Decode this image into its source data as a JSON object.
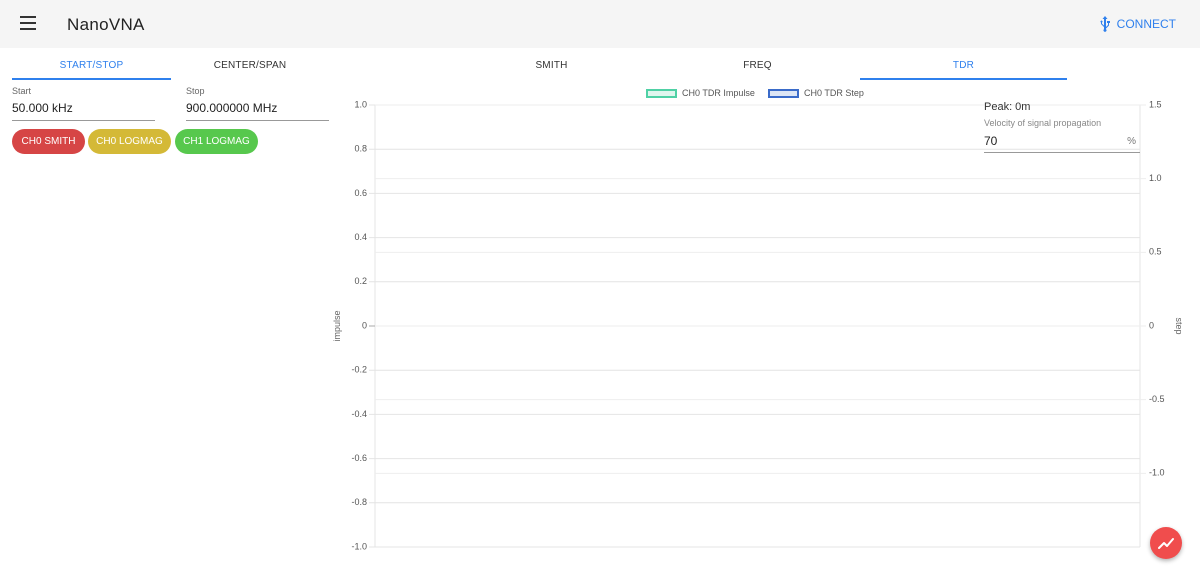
{
  "app": {
    "title": "NanoVNA",
    "connect_label": "CONNECT"
  },
  "left_tabs": [
    {
      "label": "START/STOP",
      "active": true
    },
    {
      "label": "CENTER/SPAN",
      "active": false
    }
  ],
  "start": {
    "label": "Start",
    "value": "50.000 kHz"
  },
  "stop": {
    "label": "Stop",
    "value": "900.000000 MHz"
  },
  "chips": [
    {
      "label": "CH0 SMITH",
      "color": "#d64545"
    },
    {
      "label": "CH0 LOGMAG",
      "color": "#d4b937"
    },
    {
      "label": "CH1 LOGMAG",
      "color": "#57c84d"
    }
  ],
  "chart_tabs": [
    {
      "label": "SMITH",
      "active": false
    },
    {
      "label": "FREQ",
      "active": false
    },
    {
      "label": "TDR",
      "active": true
    }
  ],
  "peak": "Peak: 0m",
  "velocity": {
    "label": "Velocity of signal propagation",
    "value": "70",
    "unit": "%"
  },
  "colors": {
    "accent": "#2f80ed",
    "fab": "#f04d4d"
  },
  "chart_data": {
    "type": "line",
    "legend": [
      {
        "name": "CH0 TDR Impulse",
        "color": "#4fd1a5"
      },
      {
        "name": "CH0 TDR Step",
        "color": "#3a6bc9"
      }
    ],
    "ylabel_left": "impulse",
    "ylabel_right": "step",
    "ylim_left": [
      -1.0,
      1.0
    ],
    "ylim_right": [
      -1.5,
      1.5
    ],
    "y_ticks_left": [
      "1.0",
      "0.8",
      "0.6",
      "0.4",
      "0.2",
      "0",
      "-0.2",
      "-0.4",
      "-0.6",
      "-0.8",
      "-1.0"
    ],
    "y_ticks_right": [
      "1.5",
      "1.0",
      "0.5",
      "0",
      "-0.5",
      "-1.0"
    ],
    "series": [
      {
        "name": "CH0 TDR Impulse",
        "values": []
      },
      {
        "name": "CH0 TDR Step",
        "values": []
      }
    ],
    "grid": true,
    "legend_position": "top-center"
  }
}
